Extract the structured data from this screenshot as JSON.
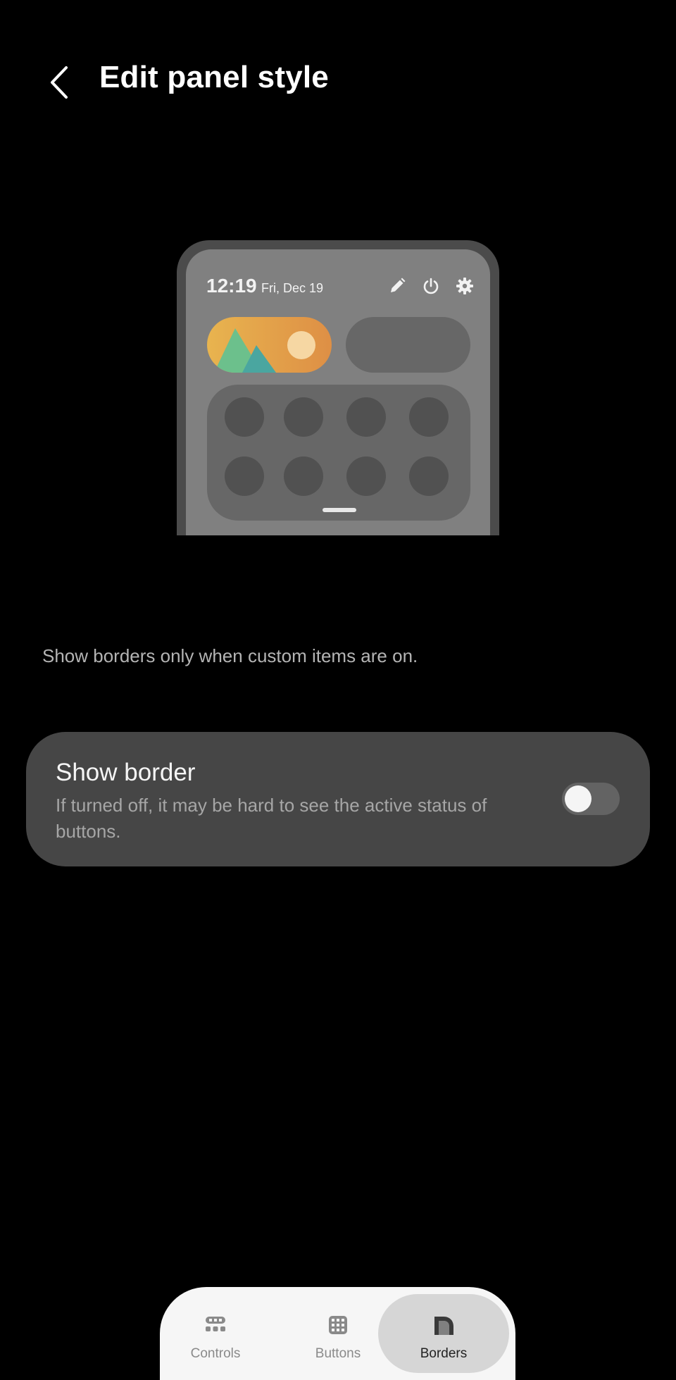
{
  "header": {
    "title": "Edit panel style",
    "back_icon": "chevron-left-icon"
  },
  "preview": {
    "time": "12:19",
    "date": "Fri, Dec 19",
    "icons": [
      "pencil-icon",
      "power-icon",
      "gear-icon"
    ]
  },
  "description": "Show borders only when custom items are on.",
  "setting": {
    "title": "Show border",
    "subtitle": "If turned off, it may be hard to see the active status of buttons.",
    "enabled": false
  },
  "bottom_nav": {
    "items": [
      {
        "label": "Controls",
        "icon": "controls-icon",
        "active": false
      },
      {
        "label": "Buttons",
        "icon": "buttons-grid-icon",
        "active": false
      },
      {
        "label": "Borders",
        "icon": "borders-icon",
        "active": true
      }
    ]
  },
  "colors": {
    "background": "#000000",
    "card": "#464646",
    "nav_background": "#f6f6f6",
    "nav_active": "#d6d6d6"
  }
}
